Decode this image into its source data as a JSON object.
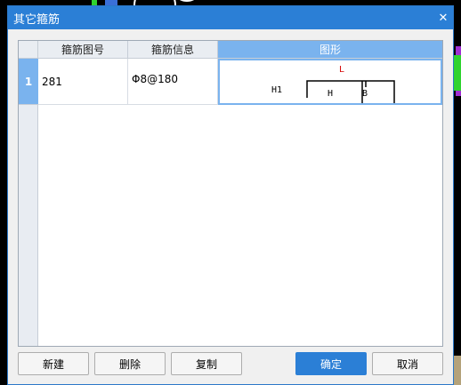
{
  "window": {
    "title": "其它箍筋",
    "close_glyph": "✕"
  },
  "table": {
    "columns": [
      "箍筋图号",
      "箍筋信息",
      "图形"
    ],
    "rows": [
      {
        "index": "1",
        "shape_no": "281",
        "info": "Φ8@180",
        "shape_labels": {
          "L": "L",
          "H1": "H1",
          "H": "H",
          "B": "B"
        }
      }
    ]
  },
  "buttons": {
    "new": "新建",
    "delete": "删除",
    "copy": "复制",
    "ok": "确定",
    "cancel": "取消"
  },
  "colors": {
    "accent": "#2b7fd6",
    "selected_header": "#7ab3ee",
    "label_red": "#d40000"
  }
}
